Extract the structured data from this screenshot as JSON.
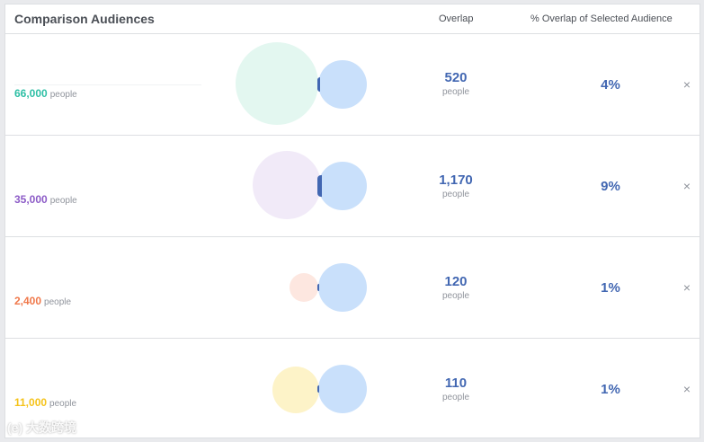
{
  "header": {
    "title": "Comparison Audiences",
    "overlap_col": "Overlap",
    "pct_col": "% Overlap of Selected Audience"
  },
  "unit_label": "people",
  "close_glyph": "×",
  "rows": [
    {
      "size": "66,000",
      "color": "#2ebfa5",
      "circle_fill": "#e3f7f0",
      "overlap": "520",
      "pct": "4%"
    },
    {
      "size": "35,000",
      "color": "#8c5bc7",
      "circle_fill": "#f1eaf8",
      "overlap": "1,170",
      "pct": "9%"
    },
    {
      "size": "2,400",
      "color": "#f0784a",
      "circle_fill": "#fde7e0",
      "overlap": "120",
      "pct": "1%"
    },
    {
      "size": "11,000",
      "color": "#f5c31a",
      "circle_fill": "#fdf3c8",
      "overlap": "110",
      "pct": "1%"
    }
  ],
  "selected_circle_fill": "#c9e0fb",
  "overlap_fill": "#4267b2",
  "watermark": "(e) 大数跨境"
}
